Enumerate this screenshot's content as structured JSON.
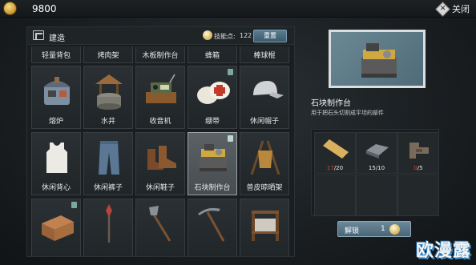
{
  "topbar": {
    "coin_icon": "coin-icon",
    "coin_amount": "9800",
    "close_label": "关闭",
    "close_icon": "close-icon"
  },
  "build_panel": {
    "title": "建造",
    "skill_label": "技能点:",
    "skill_value": "122",
    "reset_label": "重置",
    "rows": [
      [
        {
          "label": "轻量背包",
          "icon": "backpack-icon"
        },
        {
          "label": "烤肉架",
          "icon": "grill-icon"
        },
        {
          "label": "木板制作台",
          "icon": "workbench-icon"
        },
        {
          "label": "蜂箱",
          "icon": "beehive-icon"
        },
        {
          "label": "棒球棍",
          "icon": "bat-icon"
        }
      ],
      [
        {
          "label": "熔炉",
          "icon": "furnace-icon"
        },
        {
          "label": "水井",
          "icon": "well-icon"
        },
        {
          "label": "收音机",
          "icon": "radio-icon"
        },
        {
          "label": "绷带",
          "icon": "bandage-icon",
          "badge": true
        },
        {
          "label": "休闲帽子",
          "icon": "cap-icon"
        }
      ],
      [
        {
          "label": "休闲背心",
          "icon": "vest-icon"
        },
        {
          "label": "休闲裤子",
          "icon": "jeans-icon"
        },
        {
          "label": "休闲鞋子",
          "icon": "boots-icon"
        },
        {
          "label": "石块制作台",
          "icon": "stone-workbench-icon",
          "selected": true,
          "badge": true
        },
        {
          "label": "兽皮晾晒架",
          "icon": "drying-rack-icon"
        }
      ],
      [
        {
          "label": "",
          "icon": "brick-block-icon",
          "badge": true
        },
        {
          "label": "",
          "icon": "spear-icon"
        },
        {
          "label": "",
          "icon": "axe-icon"
        },
        {
          "label": "",
          "icon": "pickaxe-icon"
        },
        {
          "label": "",
          "icon": "loom-icon"
        }
      ]
    ]
  },
  "detail": {
    "name": "石块制作台",
    "description": "用于把石头切割成平坦的部件",
    "requirements": [
      {
        "icon": "wood-plank-icon",
        "have": "17",
        "need": "/20",
        "enough": false
      },
      {
        "icon": "iron-ingot-icon",
        "have": "15",
        "need": "/10",
        "enough": true
      },
      {
        "icon": "wood-clamp-icon",
        "have": "0",
        "need": "/5",
        "enough": false
      }
    ],
    "unlock_label": "解锁",
    "unlock_cost": "1"
  },
  "watermark": "欧漫露"
}
